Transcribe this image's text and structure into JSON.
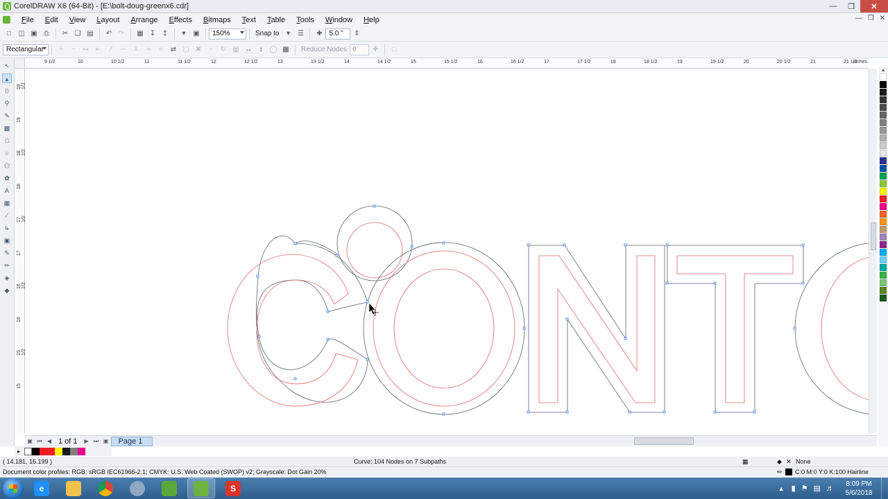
{
  "window": {
    "title": "CorelDRAW X6 (64-Bit) - [E:\\bolt-doug-greenx6.cdr]",
    "controls": {
      "minimize": "—",
      "maximize": "❐",
      "close": "✕"
    }
  },
  "menu": {
    "items": [
      "File",
      "Edit",
      "View",
      "Layout",
      "Arrange",
      "Effects",
      "Bitmaps",
      "Text",
      "Table",
      "Tools",
      "Window",
      "Help"
    ]
  },
  "standard_toolbar": {
    "zoom": "150%",
    "snap_to": "Snap to",
    "nudge": "5.0 \""
  },
  "property_bar": {
    "selection_mode": "Rectangular",
    "reduce_nodes_label": "Reduce Nodes",
    "reduce_nodes_value": "0"
  },
  "rulers": {
    "unit": "inches",
    "h_labels": [
      "9 1/2",
      "10",
      "10 1/2",
      "11",
      "11 1/2",
      "12",
      "12 1/2",
      "13",
      "13 1/2",
      "14",
      "14 1/2",
      "15",
      "15 1/2",
      "16",
      "16 1/2",
      "17",
      "17 1/2",
      "18",
      "18 1/2",
      "19",
      "19 1/2",
      "20",
      "20 1/2",
      "21",
      "21 1/2"
    ],
    "v_labels": [
      "19 1/2",
      "19",
      "18 1/2",
      "18",
      "17 1/2",
      "17",
      "16 1/2",
      "16",
      "15 1/2",
      "15"
    ]
  },
  "navigator": {
    "page_count": "1 of 1",
    "page_tab": "Page 1"
  },
  "status": {
    "cursor_position": "( 14.181, 16.199 )",
    "selection_info": "Curve: 104 Nodes on 7 Subpaths",
    "fill_label": "None",
    "outline_label": "C:0 M:0 Y:0 K:100  Hairline",
    "color_profiles": "Document color profiles: RGB: sRGB IEC61966-2.1; CMYK: U.S. Web Coated (SWOP) v2; Grayscale: Dot Gain 20%"
  },
  "taskbar": {
    "time": "8:09 PM",
    "date": "5/6/2018"
  },
  "colors": {
    "outer_path": "#5a6470",
    "inner_path": "#e06a6a",
    "node": "#3a7bd5",
    "accent": "#6cb33e"
  },
  "palette": [
    "#ffffff",
    "#000000",
    "#1a1a1a",
    "#333333",
    "#4d4d4d",
    "#666666",
    "#808080",
    "#999999",
    "#b3b3b3",
    "#cccccc",
    "#e6e6e6",
    "#2e3192",
    "#0054a6",
    "#00a651",
    "#8dc63f",
    "#fff200",
    "#ed1c24",
    "#ec008c",
    "#f26522",
    "#f7941d",
    "#c49a6c",
    "#a186be",
    "#92278f",
    "#00aeef",
    "#6dcff6",
    "#00a99d",
    "#39b54a",
    "#7cc576",
    "#598527",
    "#1b5e20"
  ],
  "document_palette": [
    "#000000",
    "#ed1c24",
    "#ed1c24",
    "#fff200",
    "#1a1a1a",
    "#7f7f7f",
    "#ec008c"
  ]
}
